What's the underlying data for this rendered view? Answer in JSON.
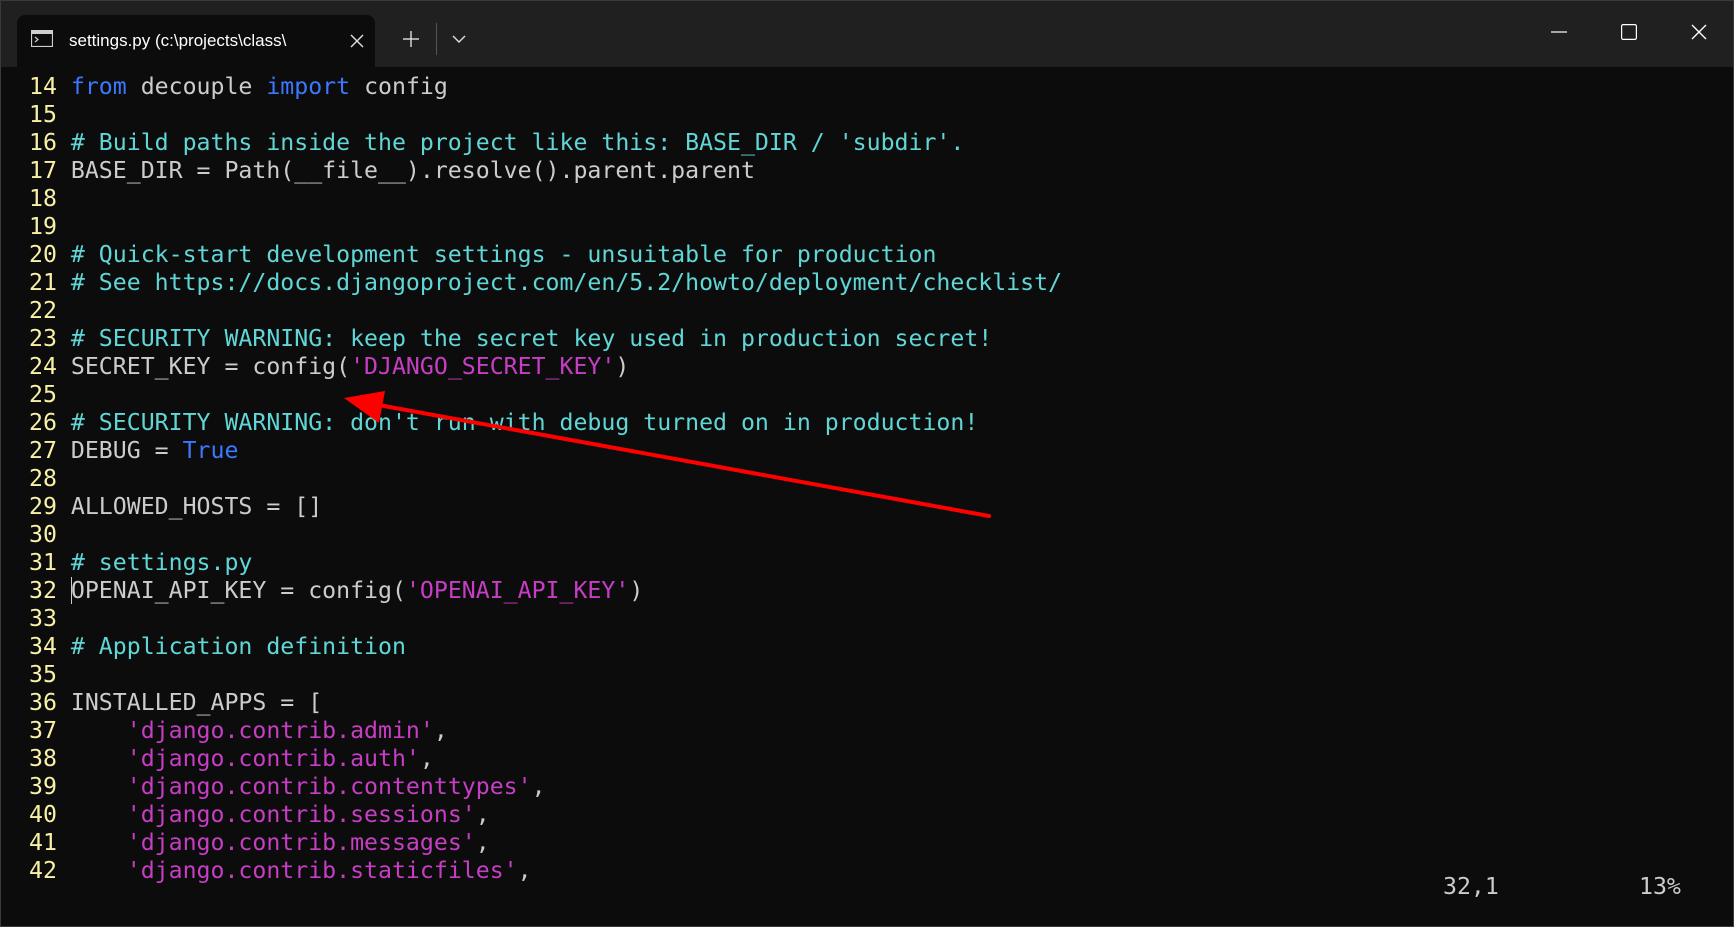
{
  "tab": {
    "icon": "terminal-icon",
    "title": "settings.py (c:\\projects\\class\\"
  },
  "titlebar": {
    "new_tab_icon": "plus-icon",
    "dropdown_icon": "chevron-down-icon",
    "minimize_icon": "minimize-icon",
    "maximize_icon": "maximize-icon",
    "close_icon": "close-icon"
  },
  "colors": {
    "background": "#0c0c0c",
    "line_number": "#f9f1a5",
    "keyword": "#3b78ff",
    "comment": "#61d6d6",
    "string": "#c73ec4",
    "text": "#cccccc",
    "annotation_arrow": "#ff0000"
  },
  "editor": {
    "lines": [
      {
        "num": "14",
        "segments": [
          {
            "t": "kw",
            "v": "from"
          },
          {
            "t": "plain",
            "v": " decouple "
          },
          {
            "t": "kw",
            "v": "import"
          },
          {
            "t": "plain",
            "v": " config"
          }
        ]
      },
      {
        "num": "15",
        "segments": []
      },
      {
        "num": "16",
        "segments": [
          {
            "t": "cm",
            "v": "# Build paths inside the project like this: BASE_DIR / 'subdir'."
          }
        ]
      },
      {
        "num": "17",
        "segments": [
          {
            "t": "plain",
            "v": "BASE_DIR = Path(__file__).resolve().parent.parent"
          }
        ]
      },
      {
        "num": "18",
        "segments": []
      },
      {
        "num": "19",
        "segments": []
      },
      {
        "num": "20",
        "segments": [
          {
            "t": "cm",
            "v": "# Quick-start development settings - unsuitable for production"
          }
        ]
      },
      {
        "num": "21",
        "segments": [
          {
            "t": "cm",
            "v": "# See https://docs.djangoproject.com/en/5.2/howto/deployment/checklist/"
          }
        ]
      },
      {
        "num": "22",
        "segments": []
      },
      {
        "num": "23",
        "segments": [
          {
            "t": "cm",
            "v": "# SECURITY WARNING: keep the secret key used in production secret!"
          }
        ]
      },
      {
        "num": "24",
        "segments": [
          {
            "t": "plain",
            "v": "SECRET_KEY = config("
          },
          {
            "t": "str",
            "v": "'DJANGO_SECRET_KEY'"
          },
          {
            "t": "plain",
            "v": ")"
          }
        ]
      },
      {
        "num": "25",
        "segments": []
      },
      {
        "num": "26",
        "segments": [
          {
            "t": "cm",
            "v": "# SECURITY WARNING: don't run with debug turned on in production!"
          }
        ]
      },
      {
        "num": "27",
        "segments": [
          {
            "t": "plain",
            "v": "DEBUG = "
          },
          {
            "t": "kw",
            "v": "True"
          }
        ]
      },
      {
        "num": "28",
        "segments": []
      },
      {
        "num": "29",
        "segments": [
          {
            "t": "plain",
            "v": "ALLOWED_HOSTS = []"
          }
        ]
      },
      {
        "num": "30",
        "segments": []
      },
      {
        "num": "31",
        "segments": [
          {
            "t": "cm",
            "v": "# settings.py"
          }
        ]
      },
      {
        "num": "32",
        "segments": [
          {
            "t": "plain",
            "v": "OPENAI_API_KEY = config("
          },
          {
            "t": "str",
            "v": "'OPENAI_API_KEY'"
          },
          {
            "t": "plain",
            "v": ")"
          }
        ]
      },
      {
        "num": "33",
        "segments": []
      },
      {
        "num": "34",
        "segments": [
          {
            "t": "cm",
            "v": "# Application definition"
          }
        ]
      },
      {
        "num": "35",
        "segments": []
      },
      {
        "num": "36",
        "segments": [
          {
            "t": "plain",
            "v": "INSTALLED_APPS = ["
          }
        ]
      },
      {
        "num": "37",
        "segments": [
          {
            "t": "plain",
            "v": "    "
          },
          {
            "t": "str",
            "v": "'django.contrib.admin'"
          },
          {
            "t": "plain",
            "v": ","
          }
        ]
      },
      {
        "num": "38",
        "segments": [
          {
            "t": "plain",
            "v": "    "
          },
          {
            "t": "str",
            "v": "'django.contrib.auth'"
          },
          {
            "t": "plain",
            "v": ","
          }
        ]
      },
      {
        "num": "39",
        "segments": [
          {
            "t": "plain",
            "v": "    "
          },
          {
            "t": "str",
            "v": "'django.contrib.contenttypes'"
          },
          {
            "t": "plain",
            "v": ","
          }
        ]
      },
      {
        "num": "40",
        "segments": [
          {
            "t": "plain",
            "v": "    "
          },
          {
            "t": "str",
            "v": "'django.contrib.sessions'"
          },
          {
            "t": "plain",
            "v": ","
          }
        ]
      },
      {
        "num": "41",
        "segments": [
          {
            "t": "plain",
            "v": "    "
          },
          {
            "t": "str",
            "v": "'django.contrib.messages'"
          },
          {
            "t": "plain",
            "v": ","
          }
        ]
      },
      {
        "num": "42",
        "segments": [
          {
            "t": "plain",
            "v": "    "
          },
          {
            "t": "str",
            "v": "'django.contrib.staticfiles'"
          },
          {
            "t": "plain",
            "v": ","
          }
        ]
      }
    ],
    "cursor_line": "32"
  },
  "status": {
    "position": "32,1",
    "scroll_percent": "13%"
  }
}
